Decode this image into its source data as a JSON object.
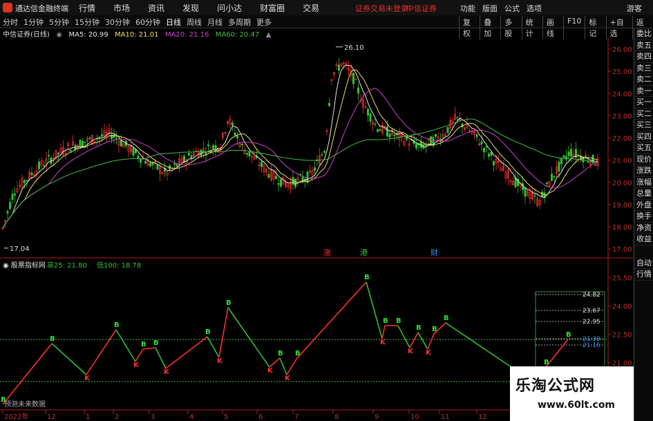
{
  "titlebar": {
    "app_title": "通达信金融终端",
    "menu": [
      "行情",
      "市场",
      "资讯",
      "发现",
      "问小达",
      "财富圈",
      "交易"
    ],
    "notice": "证券交易未登录",
    "broker": "中信证券",
    "right": [
      "功能",
      "版面",
      "公式",
      "选项"
    ],
    "guest": "游客"
  },
  "periodbar": {
    "periods": [
      "分时",
      "1分钟",
      "5分钟",
      "15分钟",
      "30分钟",
      "60分钟",
      "日线",
      "周线",
      "月线",
      "多周期",
      "更多"
    ],
    "active": "日线",
    "tools": [
      "复权",
      "叠加",
      "多股",
      "统计",
      "画线",
      "F10",
      "标记",
      "+自选",
      "返回"
    ]
  },
  "infobar": {
    "stock": "中信证券(日线)",
    "ma5": "MA5: 20.99",
    "ma10": "MA10: 21.01",
    "ma20": "MA20: 21.16",
    "ma60": "MA60: 20.47"
  },
  "main_chart": {
    "high_label": "26.10",
    "low_label": "17.04",
    "price_ticks": [
      "26.00",
      "25.00",
      "24.00",
      "23.00",
      "22.00",
      "21.00",
      "20.00",
      "19.00",
      "18.00",
      "17.00"
    ],
    "event_labels": [
      "涨",
      "港",
      "财"
    ]
  },
  "indicator": {
    "name": "股票指标网",
    "hi_label": "高25: 21.80",
    "lo_label": "低100: 18.78",
    "ticks": [
      "25.50",
      "24.00",
      "22.50",
      "21.00"
    ],
    "level_labels": [
      "24.82",
      "23.67",
      "22.95",
      "21.39",
      "21.16"
    ],
    "note": "预测未来数据",
    "buy_marker": "B",
    "sell_marker": "K"
  },
  "xaxis": {
    "labels": [
      "2022年",
      "12",
      "1",
      "2",
      "3",
      "4",
      "5",
      "6",
      "7",
      "8",
      "9",
      "10",
      "11",
      "12"
    ]
  },
  "rightpanel": {
    "items": [
      "委比",
      "卖五",
      "卖四",
      "卖三",
      "卖二",
      "卖一",
      "买一",
      "买二",
      "买三",
      "买四",
      "买五",
      "现价",
      "涨跌",
      "涨幅",
      "总量",
      "外盘",
      "换手",
      "净资",
      "收益",
      "自动",
      "行情"
    ]
  },
  "watermark": {
    "title": "乐淘公式网",
    "url": "www.60lt.com"
  },
  "colors": {
    "up": "#ff3030",
    "down": "#30c030",
    "ma5": "#e8e8e8",
    "ma10": "#f0e060",
    "ma20": "#d040d0",
    "ma60": "#40c040"
  }
}
